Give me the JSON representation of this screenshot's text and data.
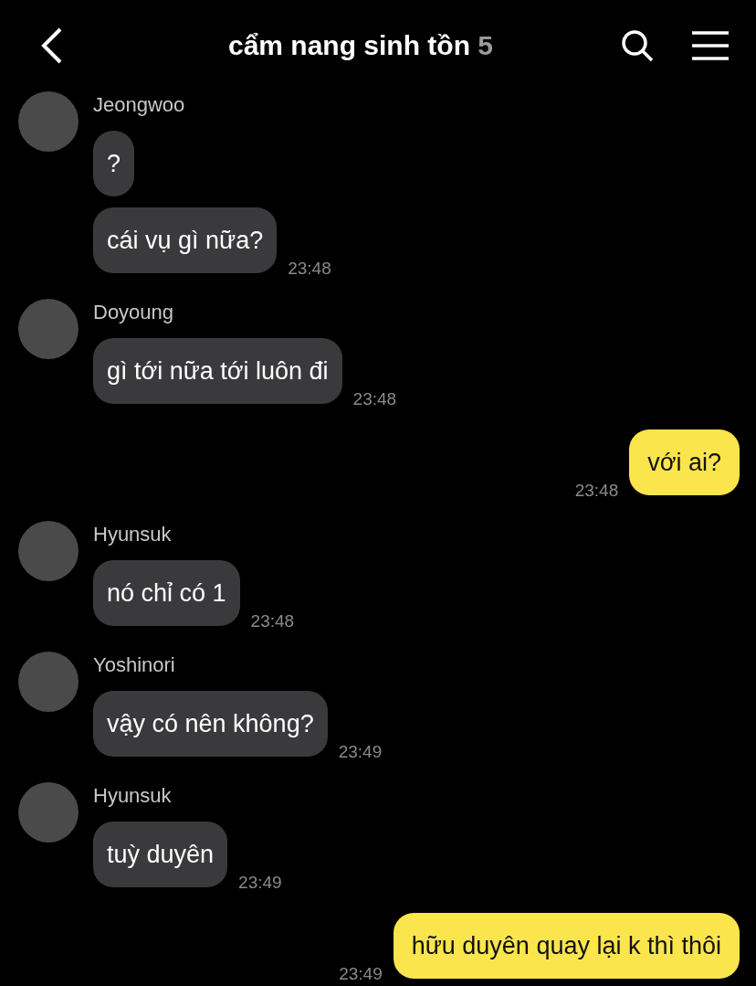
{
  "header": {
    "title": "cẩm nang sinh tồn",
    "member_count": "5"
  },
  "messages": [
    {
      "kind": "incoming",
      "sender": "Jeongwoo",
      "bubbles": [
        {
          "text": "?"
        },
        {
          "text": "cái vụ gì nữa?",
          "time": "23:48"
        }
      ]
    },
    {
      "kind": "incoming",
      "sender": "Doyoung",
      "bubbles": [
        {
          "text": "gì tới nữa tới luôn đi",
          "time": "23:48"
        }
      ]
    },
    {
      "kind": "outgoing",
      "bubbles": [
        {
          "text": "với ai?",
          "time": "23:48"
        }
      ]
    },
    {
      "kind": "incoming",
      "sender": "Hyunsuk",
      "bubbles": [
        {
          "text": "nó chỉ có 1",
          "time": "23:48"
        }
      ]
    },
    {
      "kind": "incoming",
      "sender": "Yoshinori",
      "bubbles": [
        {
          "text": "vậy có nên không?",
          "time": "23:49"
        }
      ]
    },
    {
      "kind": "incoming",
      "sender": "Hyunsuk",
      "bubbles": [
        {
          "text": "tuỳ duyên",
          "time": "23:49"
        }
      ]
    },
    {
      "kind": "outgoing",
      "bubbles": [
        {
          "text": "hữu duyên quay lại k thì thôi",
          "time": "23:49"
        }
      ]
    }
  ]
}
